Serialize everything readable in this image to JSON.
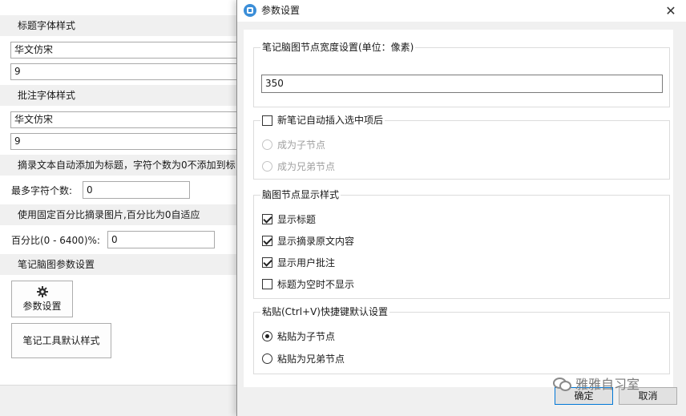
{
  "background_panel": {
    "title_font_header": "标题字体样式",
    "title_font_name": "华文仿宋",
    "title_font_size": "9",
    "annotation_font_header": "批注字体样式",
    "annotation_font_name": "华文仿宋",
    "annotation_font_size": "9",
    "excerpt_header": "摘录文本自动添加为标题，字符个数为0不添加到标",
    "max_chars_label": "最多字符个数:",
    "max_chars_value": "0",
    "image_header": "使用固定百分比摘录图片,百分比为0自适应",
    "percent_label": "百分比(0 - 6400)%:",
    "percent_value": "0",
    "mindmap_header": "笔记脑图参数设置",
    "params_button": "参数设置",
    "tool_style_button": "笔记工具默认样式"
  },
  "dialog": {
    "title": "参数设置",
    "close_glyph": "✕",
    "width_group": {
      "title": "笔记脑图节点宽度设置(单位：像素)",
      "value": "350"
    },
    "auto_insert_group": {
      "label": "新笔记自动插入选中项后",
      "checked": false,
      "options": [
        {
          "label": "成为子节点",
          "selected": false
        },
        {
          "label": "成为兄弟节点",
          "selected": false
        }
      ]
    },
    "display_group": {
      "title": "脑图节点显示样式",
      "items": [
        {
          "label": "显示标题",
          "checked": true
        },
        {
          "label": "显示摘录原文内容",
          "checked": true
        },
        {
          "label": "显示用户批注",
          "checked": true
        },
        {
          "label": "标题为空时不显示",
          "checked": false
        }
      ]
    },
    "paste_group": {
      "title": "粘贴(Ctrl+V)快捷键默认设置",
      "options": [
        {
          "label": "粘贴为子节点",
          "selected": true
        },
        {
          "label": "粘贴为兄弟节点",
          "selected": false
        }
      ]
    },
    "ok_button": "确定",
    "cancel_button": "取消"
  },
  "watermark": "雅雅自习室",
  "colors": {
    "section_header_bg": "#f0f0f0",
    "dialog_bg": "#f0f0f0",
    "primary_border": "#0078d7",
    "title_icon": "#3b8ed8"
  }
}
